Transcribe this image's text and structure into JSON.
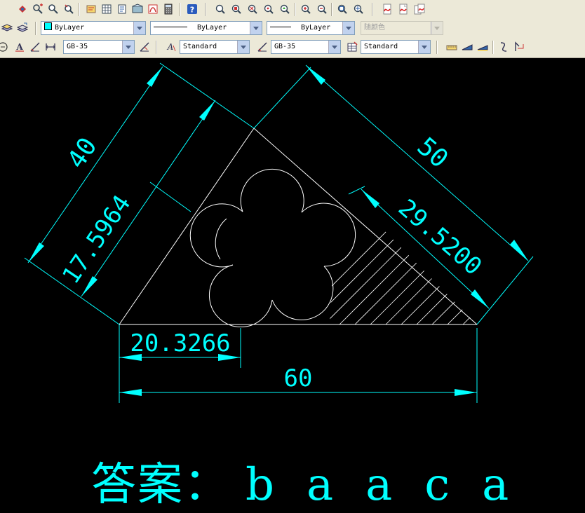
{
  "toolbar": {
    "row2": {
      "layer_dropdown": "ByLayer",
      "linetype_dropdown": "ByLayer",
      "lineweight_dropdown": "ByLayer",
      "plotstyle_dropdown": "随颜色"
    },
    "row3": {
      "dimstyle_dropdown": "GB-35",
      "textstyle_dropdown": "Standard",
      "dimstyle2_dropdown": "GB-35",
      "tablestyle_dropdown": "Standard"
    }
  },
  "drawing": {
    "dimensions": {
      "side_left": "40",
      "side_right": "50",
      "inner_left": "17.5964",
      "inner_right": "29.5200",
      "base_part": "20.3266",
      "base_total": "60"
    },
    "answer_prefix": "答案：",
    "answer_letters": [
      "b",
      "a",
      "a",
      "c",
      "a"
    ]
  },
  "colors": {
    "dimension": "#00ffff",
    "geometry": "#ffffff",
    "background": "#000000",
    "toolbar_bg": "#ece9d8"
  }
}
